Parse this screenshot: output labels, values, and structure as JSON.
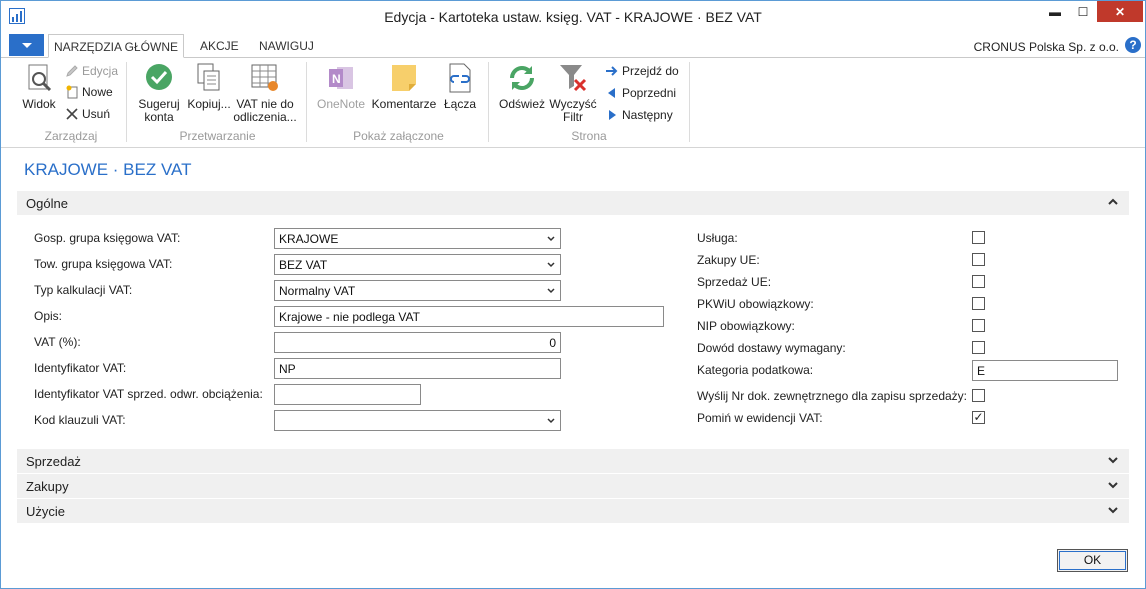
{
  "window": {
    "title": "Edycja - Kartoteka ustaw. księg. VAT - KRAJOWE · BEZ VAT",
    "minimize_glyph": "▬",
    "maximize_glyph": "☐",
    "close_glyph": "✕"
  },
  "ribbon_tabs": [
    "NARZĘDZIA GŁÓWNE",
    "AKCJE",
    "NAWIGUJ"
  ],
  "company": "CRONUS Polska Sp. z o.o.",
  "help_glyph": "?",
  "ribbon": {
    "zarzadzaj": {
      "label": "Zarządzaj",
      "widok": "Widok",
      "edycja": "Edycja",
      "nowe": "Nowe",
      "usun": "Usuń"
    },
    "przetwarzanie": {
      "label": "Przetwarzanie",
      "sugeruj_line1": "Sugeruj",
      "sugeruj_line2": "konta",
      "kopiuj": "Kopiuj...",
      "vat_line1": "VAT nie do",
      "vat_line2": "odliczenia..."
    },
    "pokaz": {
      "label": "Pokaż załączone",
      "onenote": "OneNote",
      "komentarze": "Komentarze",
      "lacza": "Łącza"
    },
    "strona": {
      "label": "Strona",
      "odswiez": "Odśwież",
      "wyczysc_line1": "Wyczyść",
      "wyczysc_line2": "Filtr",
      "przejdz": "Przejdź do",
      "poprzedni": "Poprzedni",
      "nastepny": "Następny"
    }
  },
  "page_title": "KRAJOWE · BEZ VAT",
  "sections": {
    "ogolne": "Ogólne",
    "sprzedaz": "Sprzedaż",
    "zakupy": "Zakupy",
    "uzycie": "Użycie"
  },
  "left_fields": {
    "gosp_label": "Gosp. grupa księgowa VAT:",
    "gosp_value": "KRAJOWE",
    "tow_label": "Tow. grupa księgowa VAT:",
    "tow_value": "BEZ VAT",
    "typ_label": "Typ kalkulacji VAT:",
    "typ_value": "Normalny VAT",
    "opis_label": "Opis:",
    "opis_value": "Krajowe - nie podlega VAT",
    "vat_label": "VAT (%):",
    "vat_value": "0",
    "ident_label": "Identyfikator VAT:",
    "ident_value": "NP",
    "ident_odwr_label": "Identyfikator VAT sprzed. odwr. obciążenia:",
    "ident_odwr_value": "",
    "kod_label": "Kod klauzuli VAT:",
    "kod_value": ""
  },
  "right_fields": {
    "usluga": {
      "label": "Usługa:",
      "checked": false
    },
    "zakupy_ue": {
      "label": "Zakupy UE:",
      "checked": false
    },
    "sprzedaz_ue": {
      "label": "Sprzedaż UE:",
      "checked": false
    },
    "pkwiu": {
      "label": "PKWiU obowiązkowy:",
      "checked": false
    },
    "nip": {
      "label": "NIP obowiązkowy:",
      "checked": false
    },
    "dowod": {
      "label": "Dowód dostawy wymagany:",
      "checked": false
    },
    "kategoria_label": "Kategoria podatkowa:",
    "kategoria_value": "E",
    "wyslij": {
      "label": "Wyślij Nr dok. zewnętrznego dla zapisu sprzedaży:",
      "checked": false
    },
    "pomin": {
      "label": "Pomiń w ewidencji VAT:",
      "checked": true
    },
    "check_glyph": "✓"
  },
  "ok_label": "OK",
  "colors": {
    "accent": "#2a6fc9",
    "close": "#c0392b",
    "section_bg": "#f0f0f0"
  }
}
